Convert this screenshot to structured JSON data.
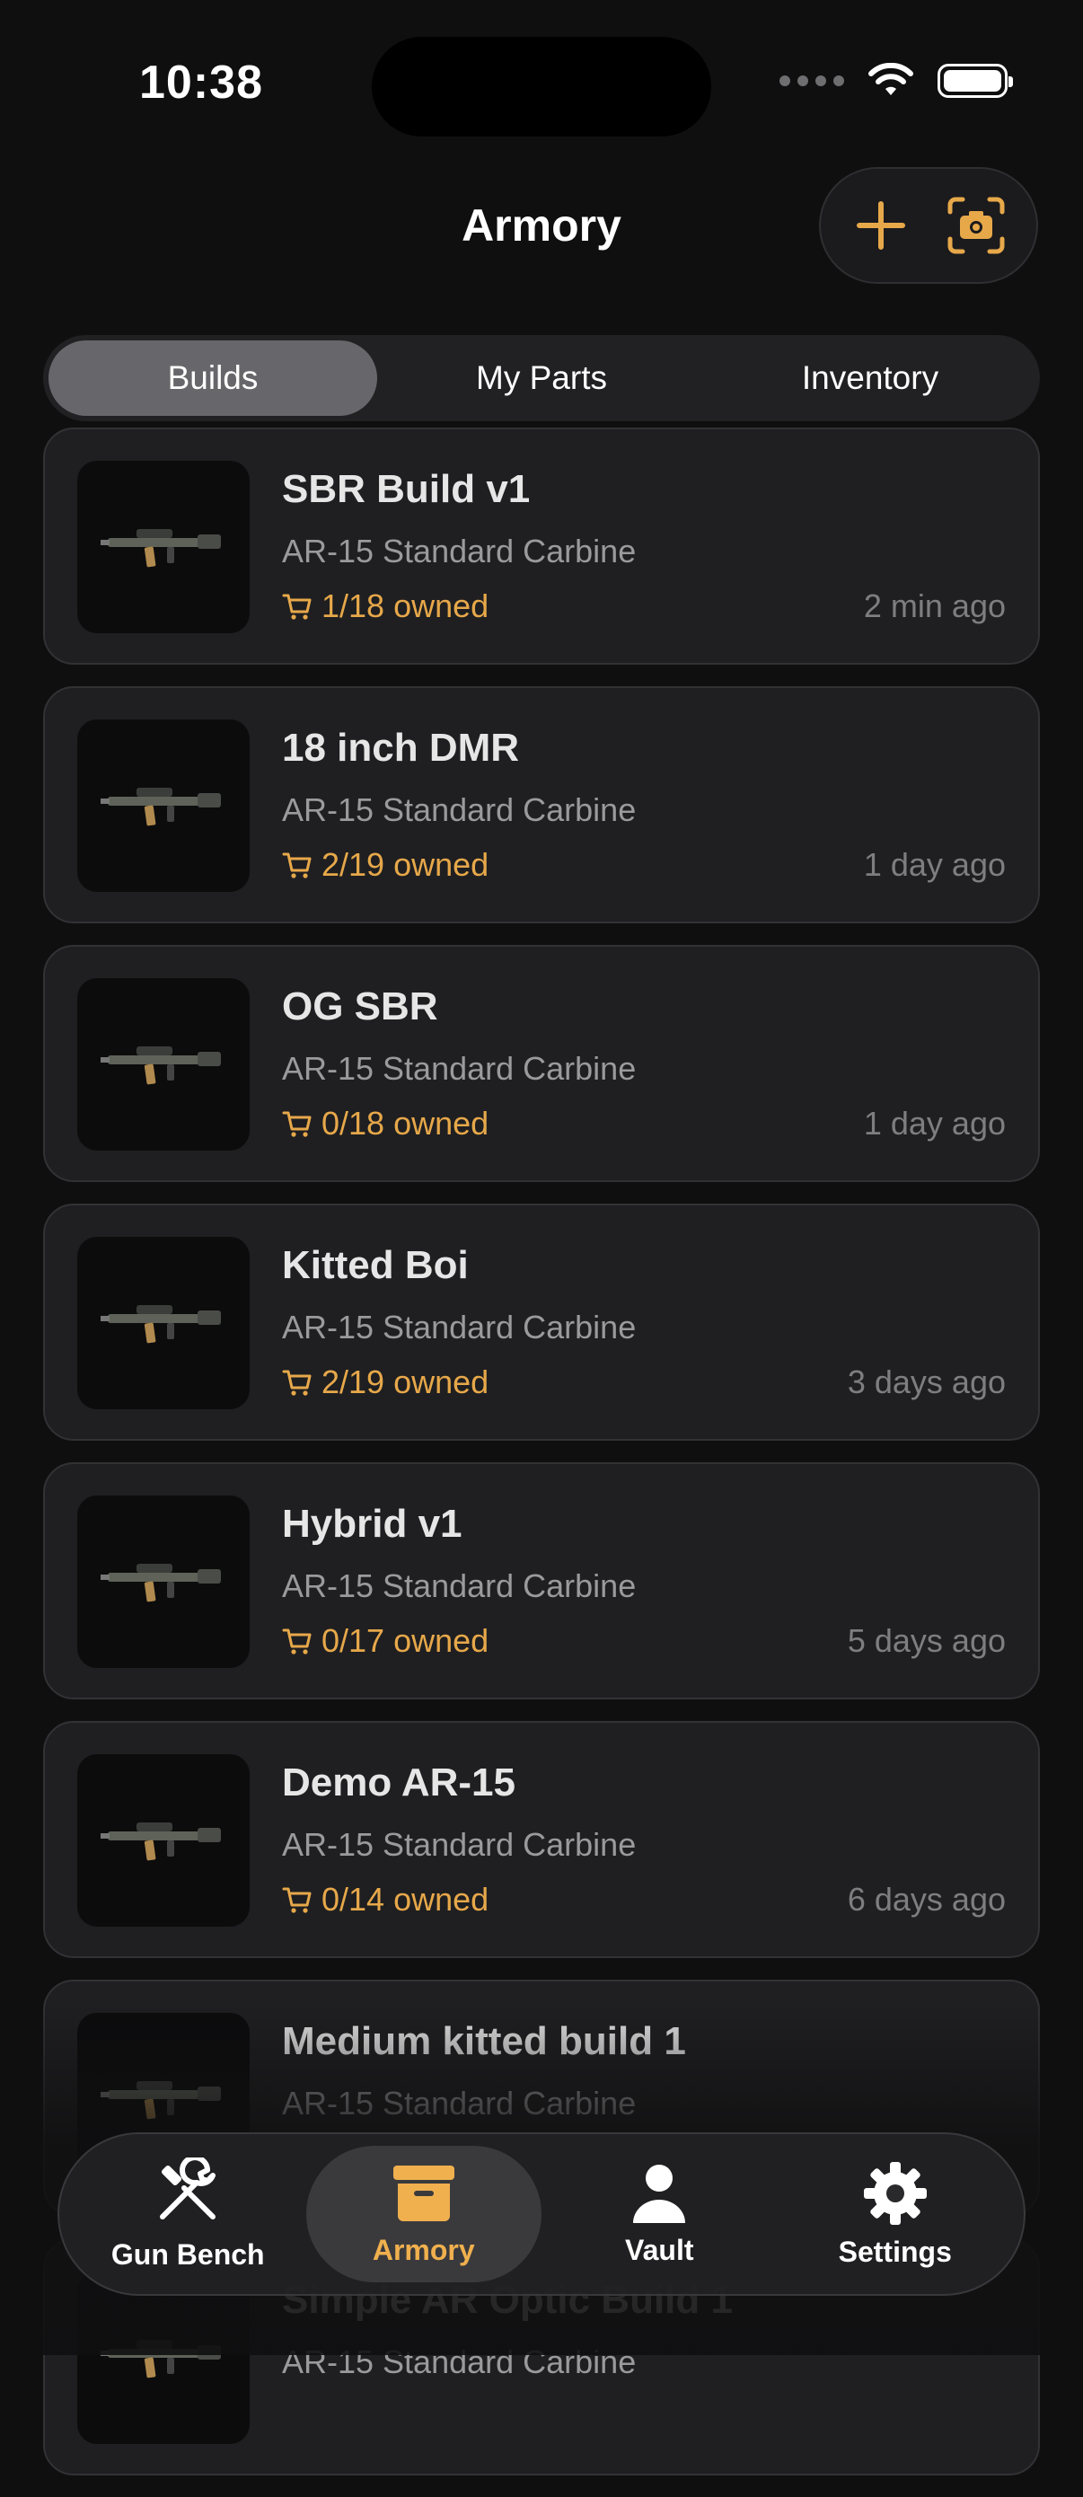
{
  "status_bar": {
    "time": "10:38"
  },
  "header": {
    "title": "Armory",
    "add_icon": "plus-icon",
    "scan_icon": "camera-scan-icon",
    "accent": "#e7a84a"
  },
  "segments": [
    {
      "label": "Builds",
      "active": true
    },
    {
      "label": "My Parts",
      "active": false
    },
    {
      "label": "Inventory",
      "active": false
    }
  ],
  "builds": [
    {
      "title": "SBR Build v1",
      "subtitle": "AR-15 Standard Carbine",
      "owned": "1/18 owned",
      "time": "2 min ago"
    },
    {
      "title": "18 inch DMR",
      "subtitle": "AR-15 Standard Carbine",
      "owned": "2/19 owned",
      "time": "1 day ago"
    },
    {
      "title": "OG SBR",
      "subtitle": "AR-15 Standard Carbine",
      "owned": "0/18 owned",
      "time": "1 day ago"
    },
    {
      "title": "Kitted Boi",
      "subtitle": "AR-15 Standard Carbine",
      "owned": "2/19 owned",
      "time": "3 days ago"
    },
    {
      "title": "Hybrid v1",
      "subtitle": "AR-15 Standard Carbine",
      "owned": "0/17 owned",
      "time": "5 days ago"
    },
    {
      "title": "Demo AR-15",
      "subtitle": "AR-15 Standard Carbine",
      "owned": "0/14 owned",
      "time": "6 days ago"
    },
    {
      "title": "Medium kitted build 1",
      "subtitle": "AR-15 Standard Carbine",
      "owned": "",
      "time": ""
    },
    {
      "title": "Simple AR Optic Build 1",
      "subtitle": "AR-15 Standard Carbine",
      "owned": "",
      "time": ""
    }
  ],
  "tabbar": [
    {
      "label": "Gun Bench",
      "icon": "wrench-screwdriver-icon",
      "active": false
    },
    {
      "label": "Armory",
      "icon": "archive-box-icon",
      "active": true
    },
    {
      "label": "Vault",
      "icon": "person-icon",
      "active": false
    },
    {
      "label": "Settings",
      "icon": "gear-icon",
      "active": false
    }
  ]
}
